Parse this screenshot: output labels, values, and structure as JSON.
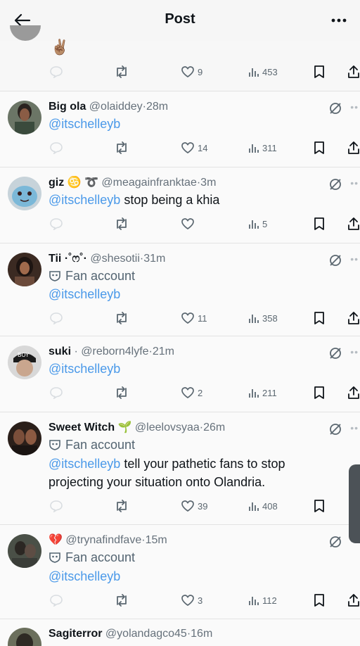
{
  "topbar": {
    "title": "Post"
  },
  "prev_post": {
    "emoji": "✌🏽",
    "views": "453",
    "likes": "9"
  },
  "replies": [
    {
      "name": "Big ola",
      "handle": "@olaiddey",
      "time": "28m",
      "lines": [
        "@itschelleyb"
      ],
      "likes": "14",
      "views": "311"
    },
    {
      "name": "giz ♋️ ➰",
      "handle": "@meagainfranktae",
      "time": "3m",
      "lines": [
        "@itschelleyb stop being a khia"
      ],
      "mention": "@itschelleyb",
      "rest": " stop being a khia",
      "likes": "",
      "views": "5"
    },
    {
      "name": "Tii ·˚ෆ˚·",
      "handle": "@shesotii",
      "time": "31m",
      "fan": "Fan account",
      "mention": "@itschelleyb",
      "likes": "11",
      "views": "358"
    },
    {
      "name": "suki",
      "handle": "@reborn4lyfe",
      "time": "21m",
      "mention": "@itschelleyb",
      "likes": "2",
      "views": "211"
    },
    {
      "name": "Sweet Witch 🌱",
      "handle": "@leelovsyaa",
      "time": "26m",
      "fan": "Fan account",
      "mention": "@itschelleyb",
      "rest1": " tell your pathetic fans to stop",
      "line2": "projecting your situation onto Olandria.",
      "likes": "39",
      "views": "408"
    },
    {
      "name": "💔",
      "handle": "@trynafindfave",
      "time": "15m",
      "fan": "Fan account",
      "mention": "@itschelleyb",
      "likes": "3",
      "views": "112"
    },
    {
      "name": "Sagiterror",
      "handle": "@yolandagco45",
      "time": "16m"
    }
  ]
}
